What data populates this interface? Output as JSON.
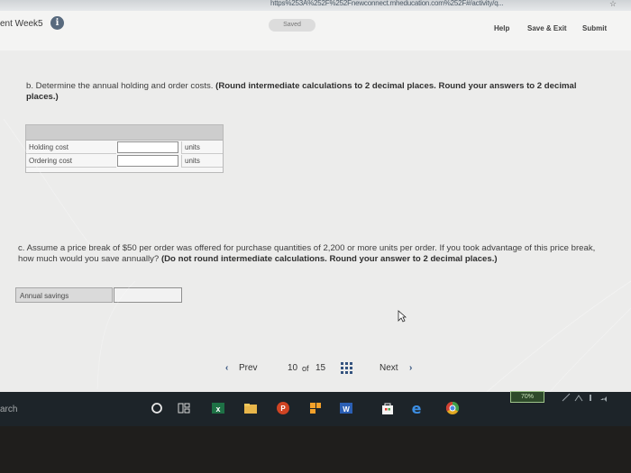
{
  "browser": {
    "url_fragment": "https%253A%252F%252Fnewconnect.mheducation.com%252F#/activity/q...",
    "bookmark_icon": "star-icon"
  },
  "header": {
    "week_label": "ent Week5",
    "saved_label": "Saved",
    "help_label": "Help",
    "save_exit_label": "Save & Exit",
    "submit_label": "Submit"
  },
  "question_b": {
    "prefix": "b. Determine the annual holding and order costs.",
    "instruction": "(Round intermediate calculations to 2 decimal places. Round your answers to 2 decimal places.)",
    "rows": [
      {
        "label": "Holding cost",
        "value": "",
        "unit": "units"
      },
      {
        "label": "Ordering cost",
        "value": "",
        "unit": "units"
      }
    ]
  },
  "question_c": {
    "prefix": "c. Assume a price break of $50 per order was offered for purchase quantities of 2,200 or more units per order. If you took advantage of this price break, how much would you save annually?",
    "instruction": "(Do not round intermediate calculations. Round your answer to 2 decimal places.)",
    "savings_label": "Annual savings",
    "savings_value": ""
  },
  "pagination": {
    "prev_label": "Prev",
    "current": "10",
    "of_label": "of",
    "total": "15",
    "next_label": "Next"
  },
  "taskbar": {
    "search_text": "arch",
    "battery_label": "70%",
    "icons": [
      "cortana-circle-icon",
      "task-view-icon",
      "excel-icon",
      "file-explorer-icon",
      "powerpoint-icon",
      "windows-store-icon",
      "word-icon",
      "store-bag-icon",
      "edge-icon",
      "chrome-icon"
    ]
  },
  "colors": {
    "info_icon": "#586a7e",
    "nav_blue": "#33527e",
    "battery_green": "#9ec48a"
  }
}
